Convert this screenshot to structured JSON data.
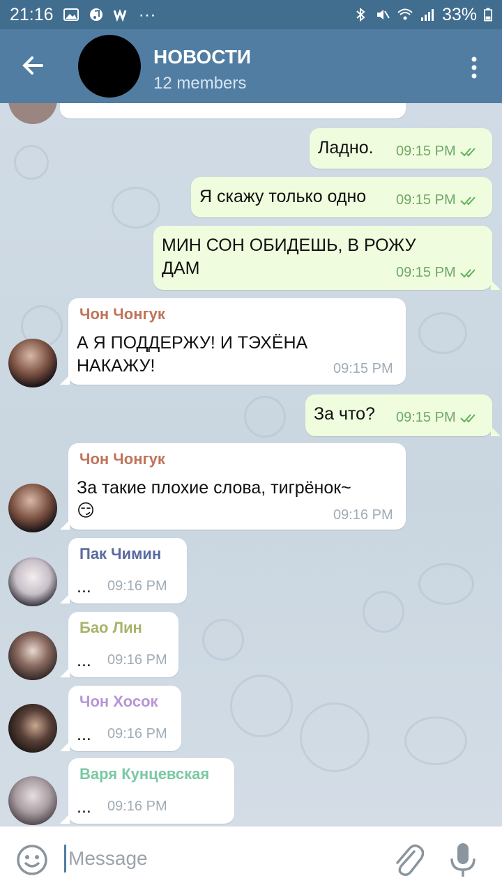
{
  "status_bar": {
    "time": "21:16",
    "battery": "33%"
  },
  "header": {
    "title": "НОВОСТИ",
    "subtitle": "12 members"
  },
  "messages": [
    {
      "type": "out",
      "text": "Ладно.",
      "time": "09:15 PM"
    },
    {
      "type": "out",
      "text": "Я скажу только одно",
      "time": "09:15 PM"
    },
    {
      "type": "out",
      "text_line1": "МИН СОН ОБИДЕШЬ, В РОЖУ",
      "text_line2": "ДАМ",
      "time": "09:15 PM"
    },
    {
      "type": "in",
      "sender": "Чон Чонгук",
      "text_line1": "А Я ПОДДЕРЖУ! И ТЭХЁНА",
      "text_line2": "НАКАЖУ!",
      "time": "09:15 PM"
    },
    {
      "type": "out",
      "text": "За что?",
      "time": "09:15 PM"
    },
    {
      "type": "in",
      "sender": "Чон Чонгук",
      "text_line1": "За такие плохие слова, тигрёнок~",
      "text_line2": "😏",
      "time": "09:16 PM"
    },
    {
      "type": "in",
      "sender": "Пак  Чимин",
      "text": "...",
      "time": "09:16 PM"
    },
    {
      "type": "in",
      "sender": "Бао Лин",
      "text": "...",
      "time": "09:16 PM"
    },
    {
      "type": "in",
      "sender": "Чон  Хосок",
      "text": "...",
      "time": "09:16 PM"
    },
    {
      "type": "in",
      "sender": "Варя Кунцевская",
      "text": "...",
      "time": "09:16 PM"
    }
  ],
  "colors": {
    "header": "#517da2",
    "sender_jungkook": "#c1735b",
    "sender_jimin": "#5a6aa0",
    "sender_bao": "#a6b46a",
    "sender_hoseok": "#b695d6",
    "sender_varya": "#7bc8a4"
  },
  "input": {
    "placeholder": "Message"
  }
}
